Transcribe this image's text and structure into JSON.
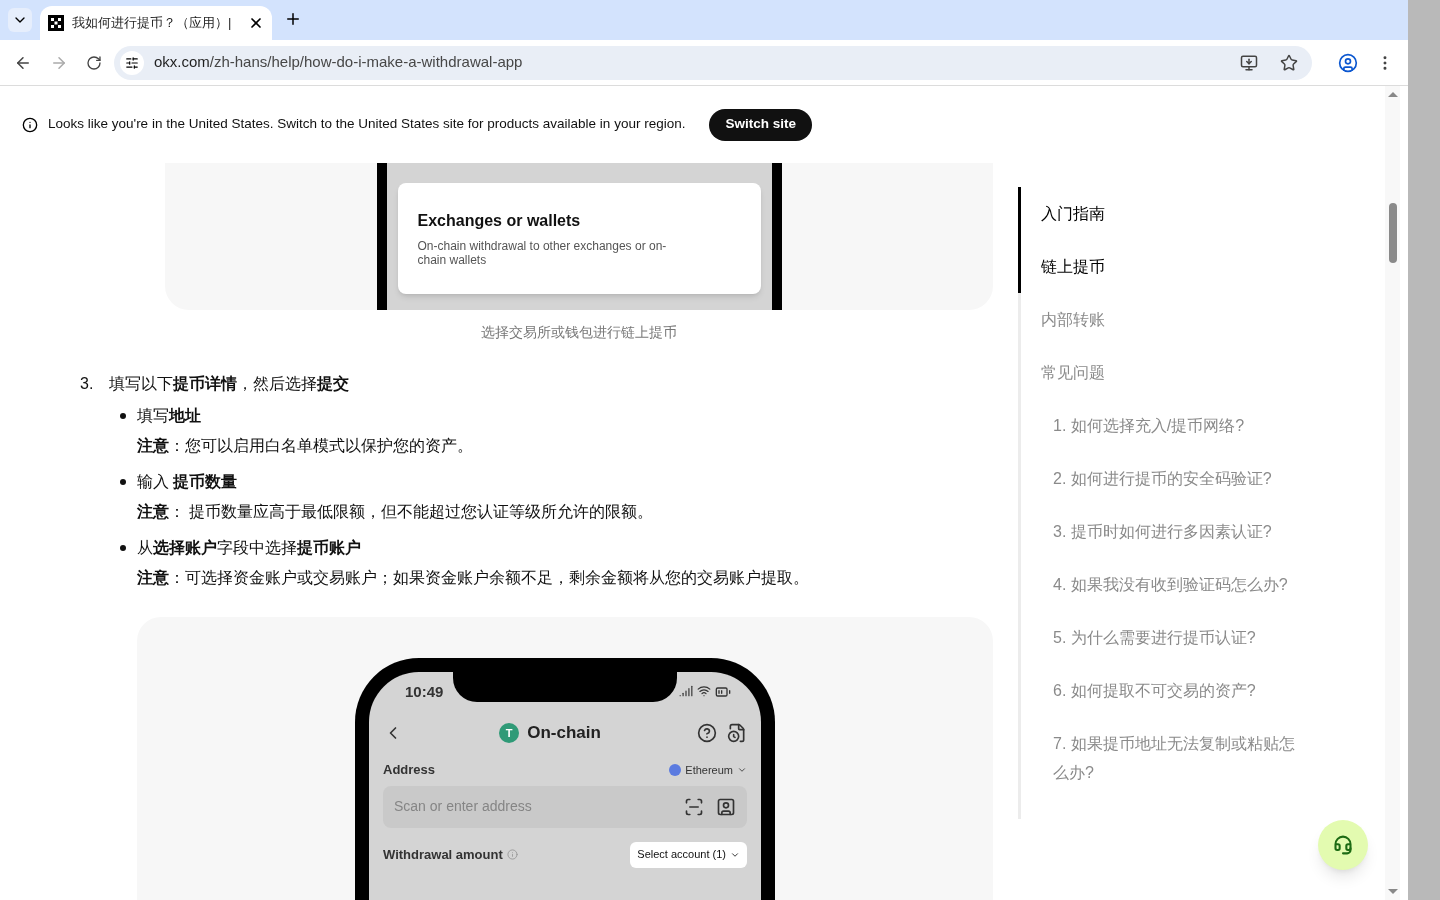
{
  "browser": {
    "tab": {
      "title": "我如何进行提币？（应用）|",
      "selected": true
    },
    "url_domain": "okx.com",
    "url_path": "/zh-hans/help/how-do-i-make-a-withdrawal-app",
    "forward_disabled": true
  },
  "banner": {
    "message": "Looks like you're in the United States. Switch to the United States site for products available in your region.",
    "button": "Switch site"
  },
  "figure_1": {
    "card_title": "Exchanges or wallets",
    "card_text": "On-chain withdrawal to other exchanges or on-chain wallets",
    "caption": "选择交易所或钱包进行链上提币"
  },
  "step": {
    "number": "3.",
    "text": "填写以下**提币详情**，然后选择**提交**",
    "bullets": [
      {
        "title": "填写**地址**",
        "note": "**注意**：您可以启用白名单模式以保护您的资产。"
      },
      {
        "title": "输入 **提币数量**",
        "note": "**注意**： 提币数量应高于最低限额，但不能超过您认证等级所允许的限额。"
      },
      {
        "title": "从**选择账户**字段中选择**提币账户**",
        "note": "**注意**：可选择资金账户或交易账户；如果资金账户余额不足，剩余金额将从您的交易账户提取。"
      }
    ]
  },
  "figure_2": {
    "time": "10:49",
    "coin_badge": "T",
    "title": "On-chain",
    "address_label": "Address",
    "network": "Ethereum",
    "address_placeholder": "Scan or enter address",
    "amount_label": "Withdrawal amount",
    "account_button": "Select account (1)"
  },
  "toc": [
    {
      "label": "入门指南",
      "selected": true
    },
    {
      "label": "链上提币",
      "selected": true
    },
    {
      "label": "内部转账",
      "selected": false
    },
    {
      "label": "常见问题",
      "selected": false,
      "children": [
        {
          "label": "1. 如何选择充入/提币网络?",
          "selected": false
        },
        {
          "label": "2. 如何进行提币的安全码验证?",
          "selected": false
        },
        {
          "label": "3. 提币时如何进行多因素认证?",
          "selected": false
        },
        {
          "label": "4. 如果我没有收到验证码怎么办?",
          "selected": false
        },
        {
          "label": "5. 为什么需要进行提币认证?",
          "selected": false
        },
        {
          "label": "6. 如何提取不可交易的资产?",
          "selected": false
        },
        {
          "label": "7. 如果提币地址无法复制或粘贴怎么办?",
          "selected": false
        }
      ]
    }
  ]
}
